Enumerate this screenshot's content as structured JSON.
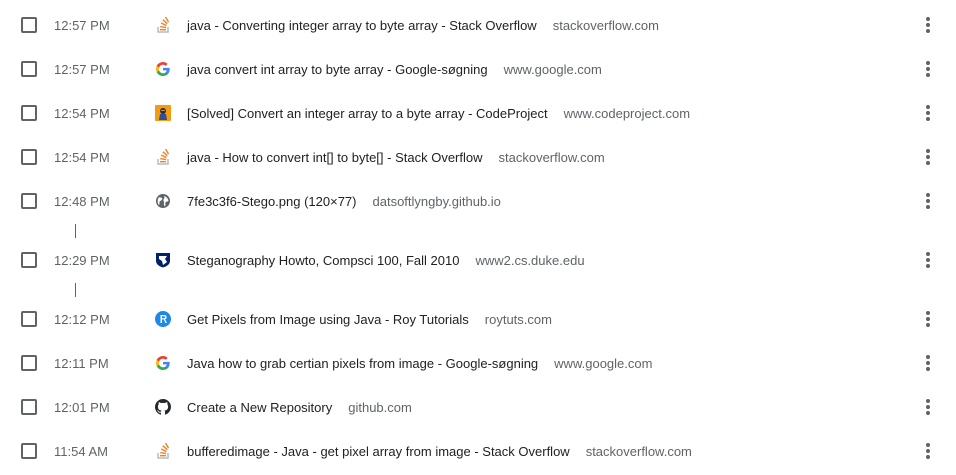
{
  "history": {
    "items": [
      {
        "time": "12:57 PM",
        "title": "java - Converting integer array to byte array - Stack Overflow",
        "domain": "stackoverflow.com",
        "icon": "stackoverflow-icon"
      },
      {
        "time": "12:57 PM",
        "title": "java convert int array to byte array - Google-søgning",
        "domain": "www.google.com",
        "icon": "google-icon"
      },
      {
        "time": "12:54 PM",
        "title": "[Solved] Convert an integer array to a byte array - CodeProject",
        "domain": "www.codeproject.com",
        "icon": "codeproject-icon"
      },
      {
        "time": "12:54 PM",
        "title": "java - How to convert int[] to byte[] - Stack Overflow",
        "domain": "stackoverflow.com",
        "icon": "stackoverflow-icon"
      },
      {
        "time": "12:48 PM",
        "title": "7fe3c3f6-Stego.png (120×77)",
        "domain": "datsoftlyngby.github.io",
        "icon": "globe-icon"
      },
      {
        "time": "12:29 PM",
        "title": "Steganography Howto, Compsci 100, Fall 2010",
        "domain": "www2.cs.duke.edu",
        "icon": "duke-icon"
      },
      {
        "time": "12:12 PM",
        "title": "Get Pixels from Image using Java - Roy Tutorials",
        "domain": "roytuts.com",
        "icon": "roytuts-icon"
      },
      {
        "time": "12:11 PM",
        "title": "Java how to grab certian pixels from image - Google-søgning",
        "domain": "www.google.com",
        "icon": "google-icon"
      },
      {
        "time": "12:01 PM",
        "title": "Create a New Repository",
        "domain": "github.com",
        "icon": "github-icon"
      },
      {
        "time": "11:54 AM",
        "title": "bufferedimage - Java - get pixel array from image - Stack Overflow",
        "domain": "stackoverflow.com",
        "icon": "stackoverflow-icon"
      }
    ]
  },
  "colors": {
    "text_primary": "#202124",
    "text_secondary": "#5f6368",
    "checkbox_border": "#5f6368",
    "stackoverflow_orange": "#f48024",
    "roytuts_blue": "#1e88e5",
    "duke_blue": "#012169"
  }
}
